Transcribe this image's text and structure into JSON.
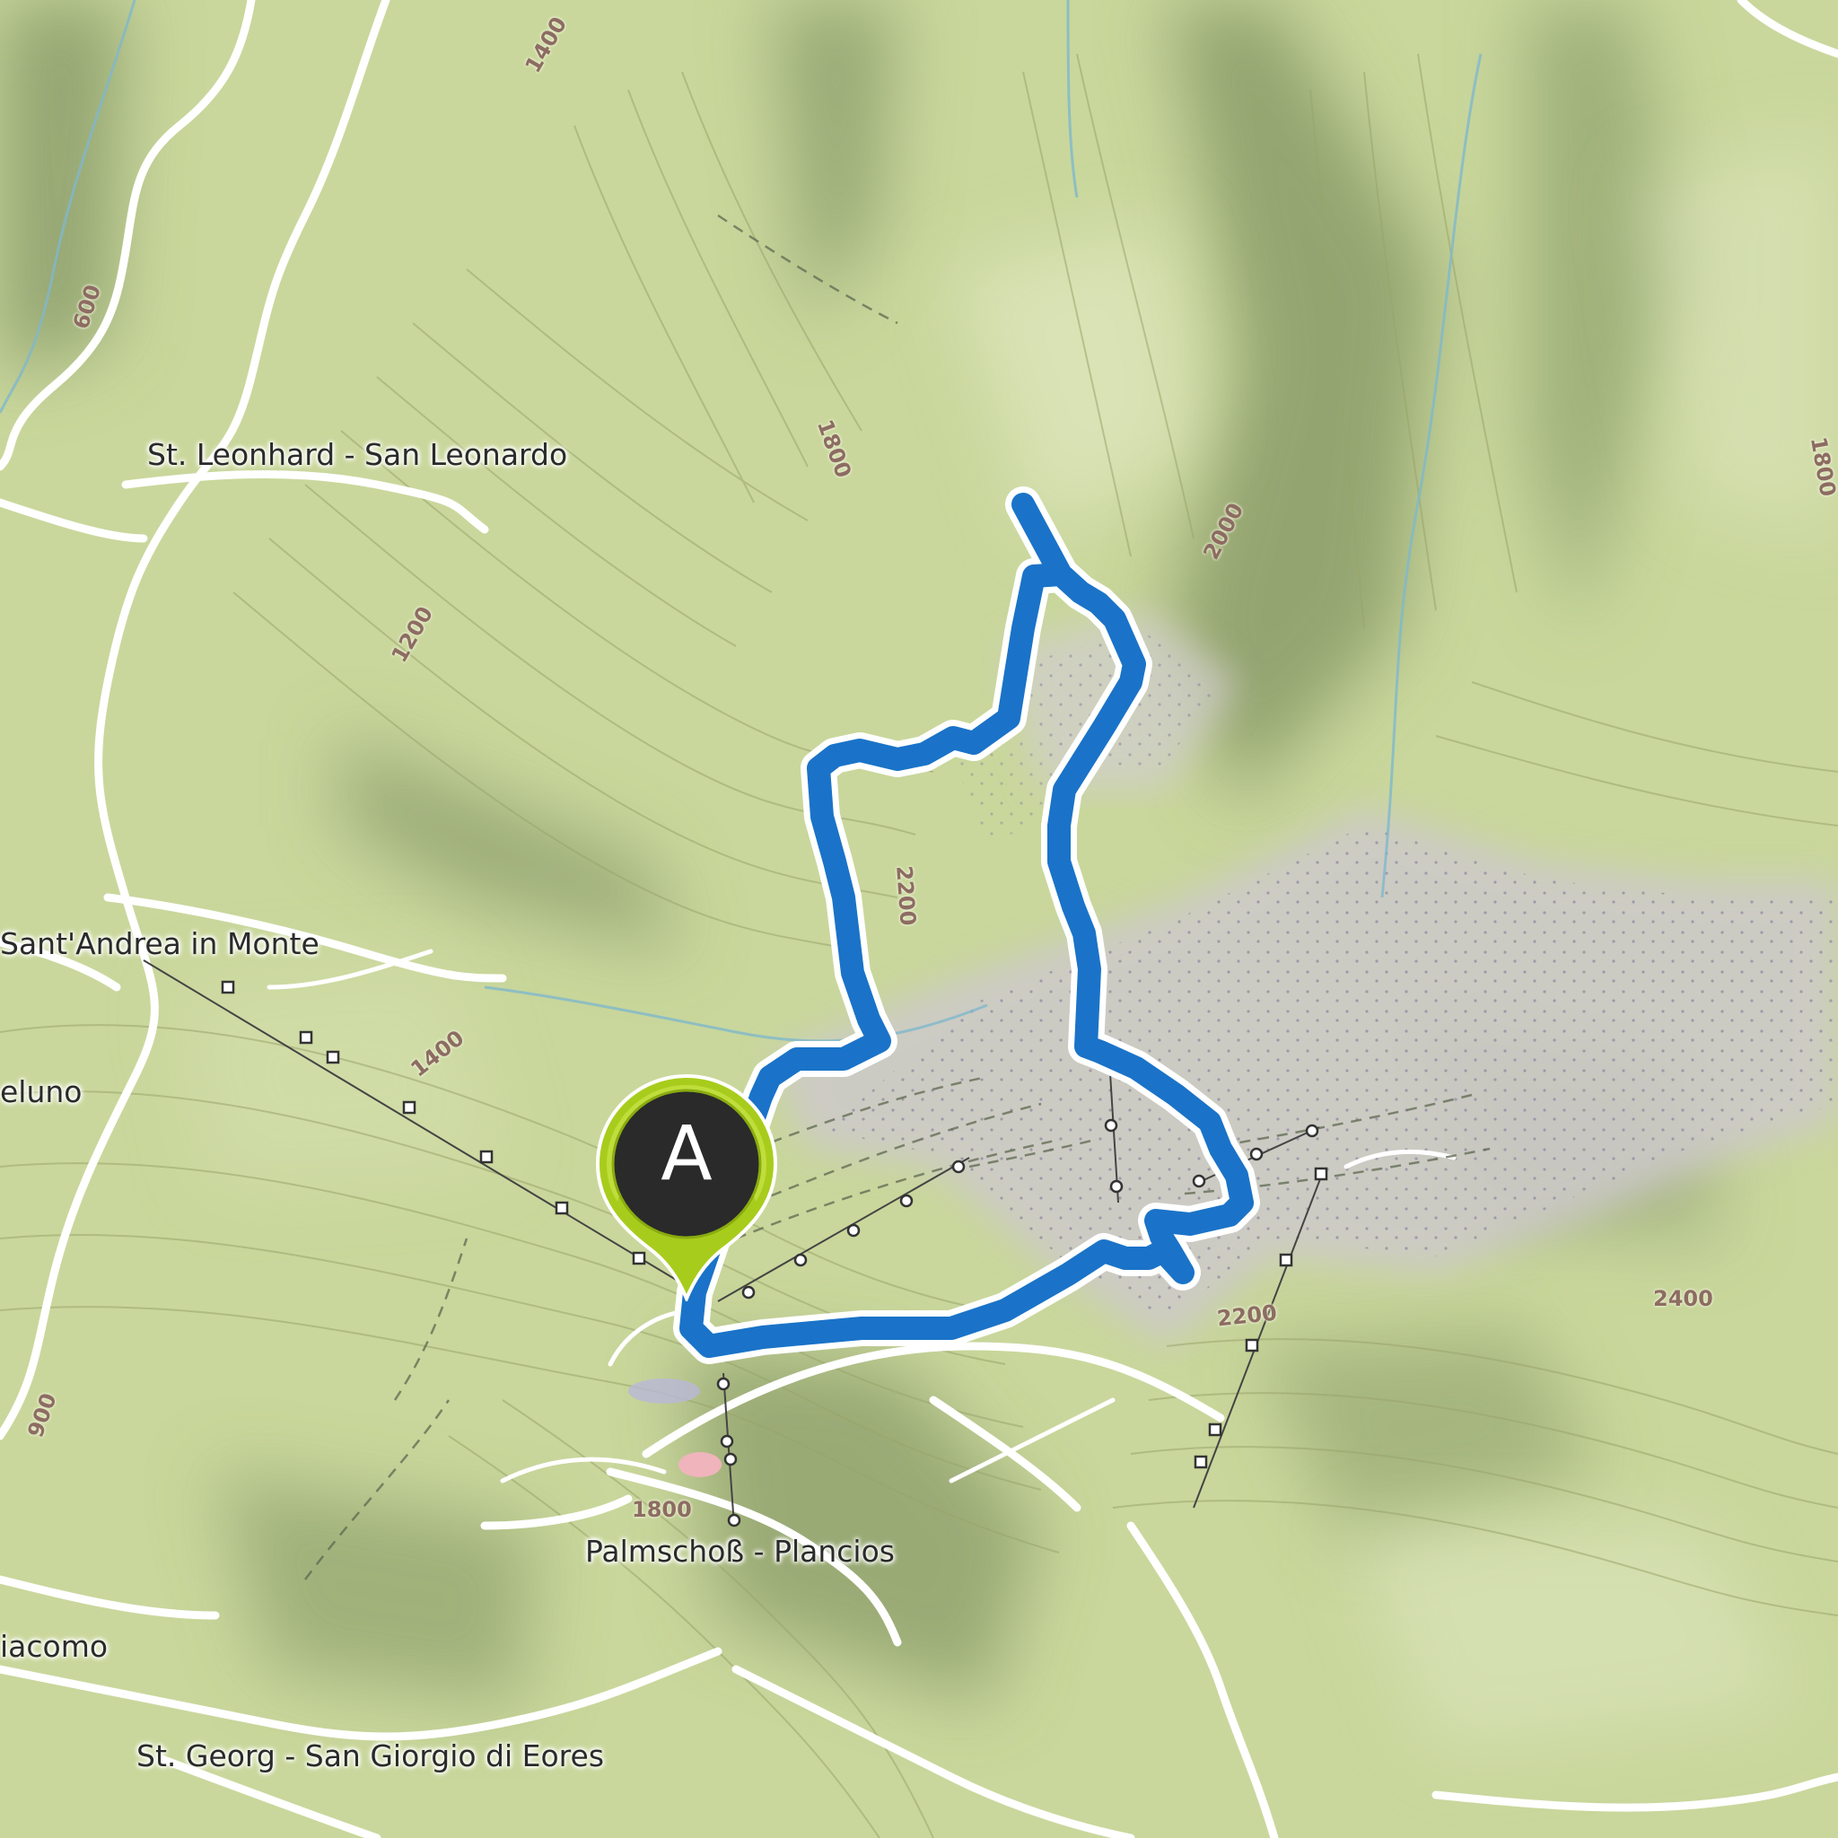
{
  "map": {
    "places": [
      {
        "id": "st-leonhard",
        "label": "St. Leonhard - San Leonardo"
      },
      {
        "id": "sant-andrea",
        "label": "Sant'Andrea in Monte"
      },
      {
        "id": "eluno",
        "label": "eluno"
      },
      {
        "id": "palmschoss",
        "label": "Palmschoß - Plancios"
      },
      {
        "id": "giacomo",
        "label": "iacomo"
      },
      {
        "id": "st-georg",
        "label": "St. Georg - San Giorgio di Eores"
      }
    ],
    "elevations": [
      {
        "id": "e1400-top",
        "label": "1400"
      },
      {
        "id": "e600",
        "label": "600"
      },
      {
        "id": "e1800-mid",
        "label": "1800"
      },
      {
        "id": "e1200",
        "label": "1200"
      },
      {
        "id": "e2000",
        "label": "2000"
      },
      {
        "id": "e1800-right",
        "label": "1800"
      },
      {
        "id": "e2200-mid",
        "label": "2200"
      },
      {
        "id": "e1400-lower",
        "label": "1400"
      },
      {
        "id": "e2200-lower",
        "label": "2200"
      },
      {
        "id": "e2400",
        "label": "2400"
      },
      {
        "id": "e1800-low",
        "label": "1800"
      },
      {
        "id": "e900",
        "label": "900"
      }
    ],
    "marker": {
      "letter": "A",
      "color": "#a8cc1c",
      "center_color": "#2a2a2a"
    },
    "route_color": "#1a73c8",
    "colors": {
      "terrain": "#c9d79c",
      "rock": "#c6c2c8",
      "road": "#ffffff",
      "river": "#8fc6d8"
    }
  }
}
